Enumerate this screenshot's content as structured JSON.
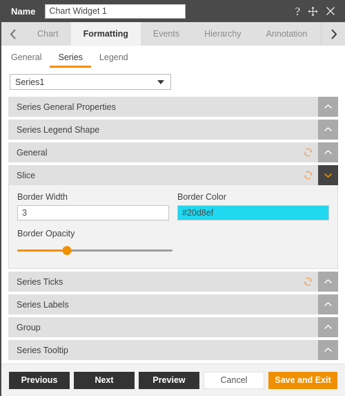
{
  "titlebar": {
    "name_label": "Name",
    "name_value": "Chart Widget 1",
    "name_placeholder": "Name",
    "icons": [
      "help-icon",
      "move-icon",
      "close-icon"
    ]
  },
  "tabstrip": {
    "prev_arrow": "chevron-left-icon",
    "next_arrow": "chevron-right-icon",
    "tabs": [
      {
        "label": "Chart",
        "active": false
      },
      {
        "label": "Formatting",
        "active": true
      },
      {
        "label": "Events",
        "active": false
      },
      {
        "label": "Hierarchy",
        "active": false
      },
      {
        "label": "Annotation",
        "active": false
      }
    ]
  },
  "subtabs": [
    {
      "label": "General",
      "active": false
    },
    {
      "label": "Series",
      "active": true
    },
    {
      "label": "Legend",
      "active": false
    }
  ],
  "series_select": {
    "value": "Series1",
    "options": [
      "Series1"
    ]
  },
  "accordion": [
    {
      "title": "Series General Properties",
      "expanded": false,
      "has_reset": false
    },
    {
      "title": "Series Legend Shape",
      "expanded": false,
      "has_reset": false
    },
    {
      "title": "General",
      "expanded": false,
      "has_reset": true
    },
    {
      "title": "Slice",
      "expanded": true,
      "has_reset": true
    },
    {
      "title": "Series Ticks",
      "expanded": false,
      "has_reset": true
    },
    {
      "title": "Series Labels",
      "expanded": false,
      "has_reset": false
    },
    {
      "title": "Group",
      "expanded": false,
      "has_reset": false
    },
    {
      "title": "Series Tooltip",
      "expanded": false,
      "has_reset": false
    }
  ],
  "slice_panel": {
    "border_width_label": "Border Width",
    "border_width_value": "3",
    "border_color_label": "Border Color",
    "border_color_value": "#20d8ef",
    "border_color_swatch": "#20d8ef",
    "border_opacity_label": "Border Opacity",
    "border_opacity_percent": 32
  },
  "footer": {
    "previous": "Previous",
    "next": "Next",
    "preview": "Preview",
    "cancel": "Cancel",
    "save_and_exit": "Save and Exit"
  },
  "colors": {
    "accent": "#f09000",
    "titlebar": "#4a4a4a",
    "accordion_header": "#e0e0e0",
    "toggle_collapsed": "#aaaaaa",
    "toggle_expanded": "#434343"
  }
}
